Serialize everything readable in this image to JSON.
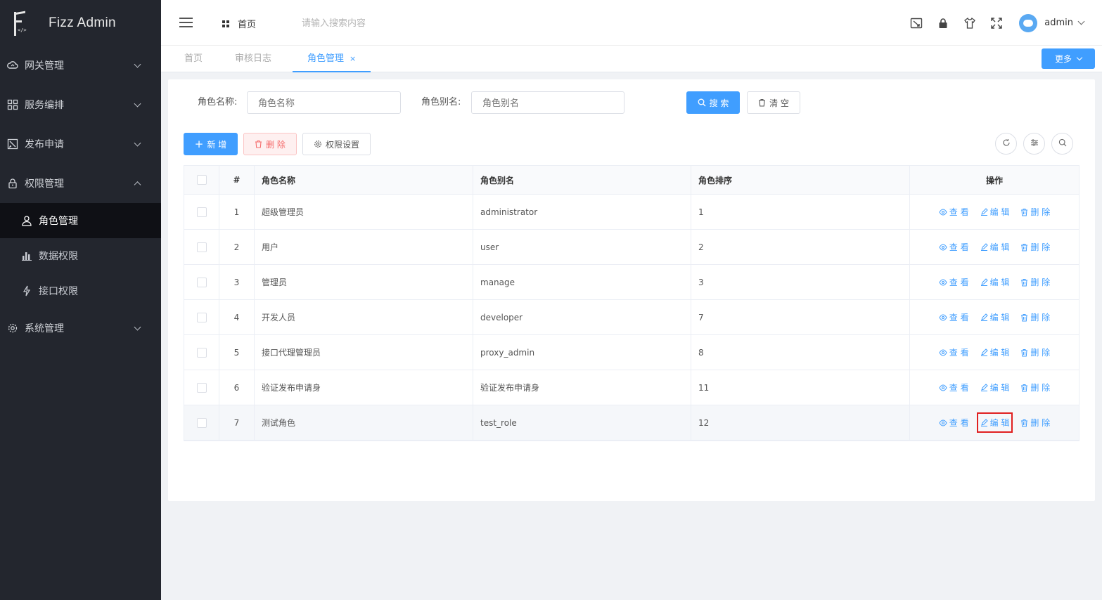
{
  "app": {
    "title": "Fizz Admin"
  },
  "sidebar": {
    "groups": [
      {
        "label": "网关管理"
      },
      {
        "label": "服务编排"
      },
      {
        "label": "发布申请"
      },
      {
        "label": "权限管理"
      },
      {
        "label": "系统管理"
      }
    ],
    "sub_items": [
      {
        "label": "角色管理"
      },
      {
        "label": "数据权限"
      },
      {
        "label": "接口权限"
      }
    ]
  },
  "header": {
    "home_label": "首页",
    "search_placeholder": "请输入搜索内容",
    "user_name": "admin"
  },
  "tabs": [
    {
      "label": "首页"
    },
    {
      "label": "审核日志"
    },
    {
      "label": "角色管理"
    }
  ],
  "tab_close": "×",
  "more_label": "更多",
  "filters": {
    "role_name_label": "角色名称:",
    "role_name_placeholder": "角色名称",
    "role_alias_label": "角色别名:",
    "role_alias_placeholder": "角色别名",
    "search_label": "搜 索",
    "clear_label": "清 空"
  },
  "toolbar": {
    "add_label": "新 增",
    "delete_label": "删 除",
    "perm_label": "权限设置"
  },
  "table": {
    "headers": {
      "idx": "#",
      "name": "角色名称",
      "alias": "角色别名",
      "sort": "角色排序",
      "ops": "操作"
    },
    "op_view": "查 看",
    "op_edit": "编 辑",
    "op_delete": "删 除",
    "rows": [
      {
        "idx": "1",
        "name": "超级管理员",
        "alias": "administrator",
        "sort": "1"
      },
      {
        "idx": "2",
        "name": "用户",
        "alias": "user",
        "sort": "2"
      },
      {
        "idx": "3",
        "name": "管理员",
        "alias": "manage",
        "sort": "3"
      },
      {
        "idx": "4",
        "name": "开发人员",
        "alias": "developer",
        "sort": "7"
      },
      {
        "idx": "5",
        "name": "接口代理管理员",
        "alias": "proxy_admin",
        "sort": "8"
      },
      {
        "idx": "6",
        "name": "验证发布申请身",
        "alias": "验证发布申请身",
        "sort": "11"
      },
      {
        "idx": "7",
        "name": "测试角色",
        "alias": "test_role",
        "sort": "12"
      }
    ]
  }
}
